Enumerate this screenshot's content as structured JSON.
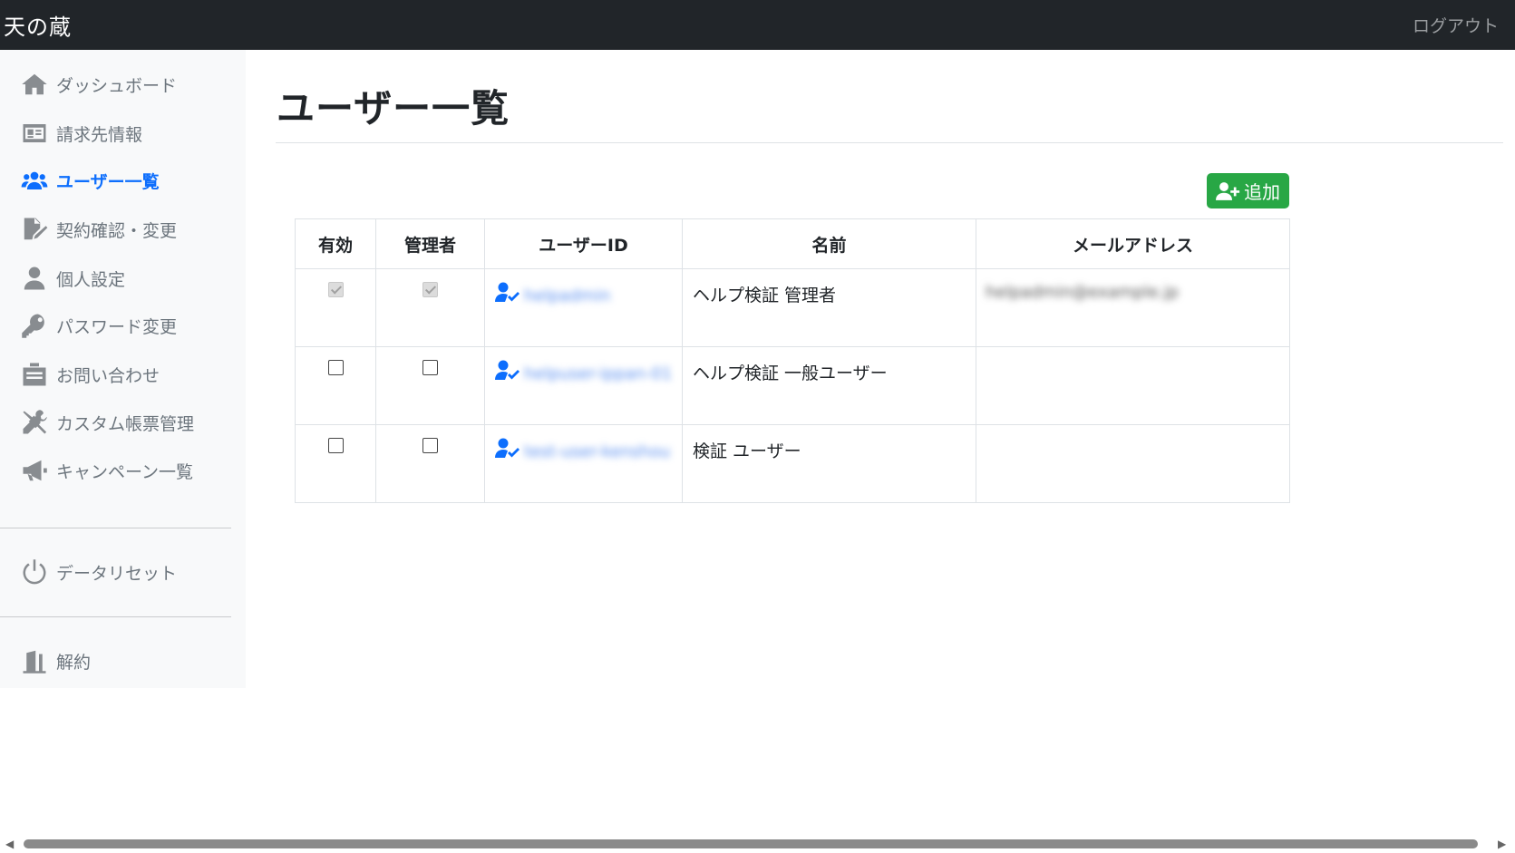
{
  "navbar": {
    "brand": "天の蔵",
    "logout": "ログアウト"
  },
  "sidebar": {
    "items": [
      {
        "label": "ダッシュボード",
        "icon": "home-icon"
      },
      {
        "label": "請求先情報",
        "icon": "id-card-icon"
      },
      {
        "label": "ユーザー一覧",
        "icon": "users-icon",
        "active": true
      },
      {
        "label": "契約確認・変更",
        "icon": "file-signature-icon"
      },
      {
        "label": "個人設定",
        "icon": "user-icon"
      },
      {
        "label": "パスワード変更",
        "icon": "key-icon"
      },
      {
        "label": "お問い合わせ",
        "icon": "mail-box-icon"
      },
      {
        "label": "カスタム帳票管理",
        "icon": "tools-icon"
      },
      {
        "label": "キャンペーン一覧",
        "icon": "megaphone-icon"
      },
      {
        "label": "データリセット",
        "icon": "power-icon"
      },
      {
        "label": "解約",
        "icon": "door-exit-icon"
      }
    ]
  },
  "main": {
    "title": "ユーザー一覧",
    "add_button": "追加",
    "table": {
      "headers": [
        "有効",
        "管理者",
        "ユーザーID",
        "名前",
        "メールアドレス"
      ],
      "rows": [
        {
          "enabled": true,
          "admin": true,
          "user_id": "helpadmin",
          "name": "ヘルプ検証 管理者",
          "email": "helpadmin@example.jp"
        },
        {
          "enabled": false,
          "admin": false,
          "user_id": "helpuser-ippan-01",
          "name": "ヘルプ検証 一般ユーザー",
          "email": ""
        },
        {
          "enabled": false,
          "admin": false,
          "user_id": "test-user-kenshou",
          "name": "検証 ユーザー",
          "email": ""
        }
      ]
    }
  },
  "colors": {
    "navbar": "#212529",
    "active": "#0d6efd",
    "add_button": "#28a745",
    "sidebar_bg": "#f8f9fa"
  }
}
